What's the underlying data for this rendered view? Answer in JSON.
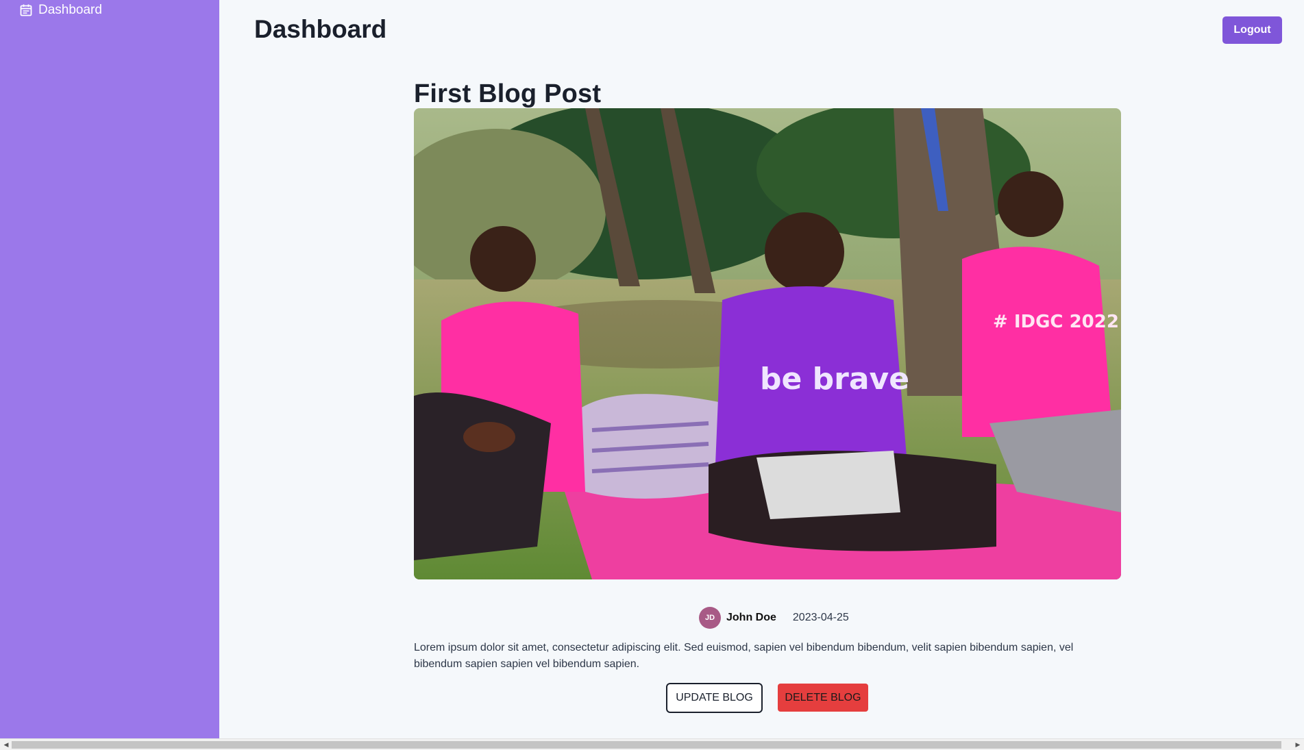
{
  "sidebar": {
    "items": [
      {
        "label": "Dashboard",
        "icon": "calendar-icon"
      }
    ]
  },
  "header": {
    "title": "Dashboard",
    "logout_label": "Logout"
  },
  "post": {
    "title": "First Blog Post",
    "image_alt": "",
    "author_initials": "JD",
    "author_name": "John Doe",
    "date": "2023-04-25",
    "body": "Lorem ipsum dolor sit amet, consectetur adipiscing elit. Sed euismod, sapien vel bibendum bibendum, velit sapien bibendum sapien, vel bibendum sapien sapien vel bibendum sapien.",
    "update_label": "UPDATE BLOG",
    "delete_label": "DELETE BLOG"
  },
  "colors": {
    "sidebar_bg": "#9b78ea",
    "accent": "#7f56d9",
    "danger": "#e53e3e",
    "page_bg": "#f5f8fb",
    "avatar_bg": "#a85a86"
  }
}
